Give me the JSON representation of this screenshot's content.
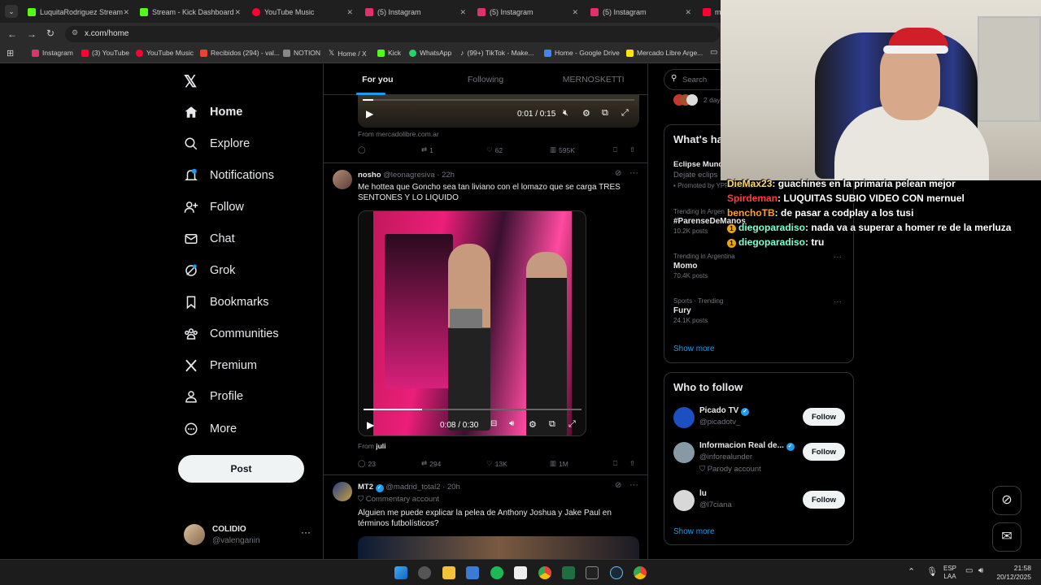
{
  "browser": {
    "tabs": [
      {
        "label": "LuquitaRodriguez Stream",
        "color": "#53fc18"
      },
      {
        "label": "Stream - Kick Dashboard",
        "color": "#53fc18"
      },
      {
        "label": "YouTube Music",
        "color": "#ff0033"
      },
      {
        "label": "(5) Instagram",
        "color": "#e1306c"
      },
      {
        "label": "(5) Instagram",
        "color": "#e1306c"
      },
      {
        "label": "(5) Instagram",
        "color": "#e1306c"
      },
      {
        "label": "m",
        "color": "#ff0033"
      }
    ],
    "url": "x.com/home",
    "bookmarks": [
      {
        "label": "Instagram",
        "color": "#e1306c"
      },
      {
        "label": "(3) YouTube",
        "color": "#ff0033"
      },
      {
        "label": "YouTube Music",
        "color": "#ff0033"
      },
      {
        "label": "Recibidos (294) - val...",
        "color": "#ea4335"
      },
      {
        "label": "NOTION",
        "color": "#888888"
      },
      {
        "label": "Home / X",
        "color": "#ffffff"
      },
      {
        "label": "Kick",
        "color": "#53fc18"
      },
      {
        "label": "WhatsApp",
        "color": "#25d366"
      },
      {
        "label": "(99+) TikTok - Make...",
        "color": "#ffffff"
      },
      {
        "label": "Home - Google Drive",
        "color": "#4285f4"
      },
      {
        "label": "Mercado Libre Arge...",
        "color": "#ffe600"
      }
    ]
  },
  "sidebar": {
    "items": [
      {
        "label": "Home",
        "icon": "home-icon"
      },
      {
        "label": "Explore",
        "icon": "search-icon"
      },
      {
        "label": "Notifications",
        "icon": "bell-icon",
        "badge": "1"
      },
      {
        "label": "Follow",
        "icon": "person-add-icon"
      },
      {
        "label": "Chat",
        "icon": "mail-icon"
      },
      {
        "label": "Grok",
        "icon": "grok-icon"
      },
      {
        "label": "Bookmarks",
        "icon": "bookmark-icon"
      },
      {
        "label": "Communities",
        "icon": "communities-icon"
      },
      {
        "label": "Premium",
        "icon": "x-logo-icon"
      },
      {
        "label": "Profile",
        "icon": "profile-icon"
      },
      {
        "label": "More",
        "icon": "more-circle-icon"
      }
    ],
    "post_label": "Post",
    "account": {
      "name": "COLIDIO",
      "handle": "@valenganin"
    }
  },
  "feed": {
    "tabs": [
      "For you",
      "Following",
      "MERNOSKETTI"
    ],
    "top_video": {
      "time": "0:01 / 0:15",
      "source": "From mercadolibre.com.ar",
      "reposts": "1",
      "likes": "62",
      "views": "595K"
    },
    "tweet1": {
      "name": "nosho",
      "handle": "@leonagresiva",
      "time": "· 22h",
      "text": "Me hottea que Goncho sea tan liviano con el lomazo que se carga TRES SENTONES Y LO LIQUIDO",
      "video_time": "0:08 / 0:30",
      "video_progress": 0.27,
      "from_prefix": "From",
      "from_name": "juli",
      "replies": "23",
      "reposts": "294",
      "likes": "13K",
      "views": "1M"
    },
    "tweet2": {
      "name": "MT2",
      "handle": "@madrid_total2",
      "time": "· 20h",
      "label": "Commentary account",
      "text": "Alguien me puede explicar la pelea de Anthony Joshua y Jake Paul en términos futbolísticos?"
    }
  },
  "right": {
    "search_placeholder": "Search",
    "events_time": "2 day",
    "whats_happening_title": "What's ha",
    "event": {
      "title": "Eclipse Mund",
      "sub": "Dejate eclips",
      "promoted": "Promoted by YPF Servicio"
    },
    "trends": [
      {
        "label": "Trending in Argen",
        "name": "#ParenseDeManos",
        "posts": "10.2K posts"
      },
      {
        "label": "Trending in Argentina",
        "name": "Momo",
        "posts": "70.4K posts"
      },
      {
        "label": "Sports · Trending",
        "name": "Fury",
        "posts": "24.1K posts"
      }
    ],
    "show_more": "Show more",
    "who_to_follow_title": "Who to follow",
    "follow_label": "Follow",
    "suggestions": [
      {
        "name": "Picado TV",
        "handle": "@picadotv_",
        "note": ""
      },
      {
        "name": "Informacion Real de...",
        "handle": "@inforealunder",
        "note": "Parody account"
      },
      {
        "name": "lu",
        "handle": "@l7ciana",
        "note": ""
      }
    ],
    "show_more_2": "Show more"
  },
  "chat": [
    {
      "user": "DieMax23",
      "color": "#ffd966",
      "msg": "guachines en la primaria pelean mejor"
    },
    {
      "user": "Spirdeman",
      "color": "#ff3b3b",
      "msg": "LUQUITAS SUBIO VIDEO CON mernuel"
    },
    {
      "user": "benchoTB",
      "color": "#ff9f1a",
      "msg": "de pasar a codplay a los tusi"
    },
    {
      "user": "diegoparadiso",
      "color": "#7fffd4",
      "msg": "nada va a superar a homer re de la merluza"
    },
    {
      "user": "diegoparadiso",
      "color": "#7fffd4",
      "msg": "tru"
    }
  ],
  "taskbar": {
    "lang": "ESP",
    "layout": "LAA",
    "time": "21:58",
    "date": "20/12/2025"
  }
}
